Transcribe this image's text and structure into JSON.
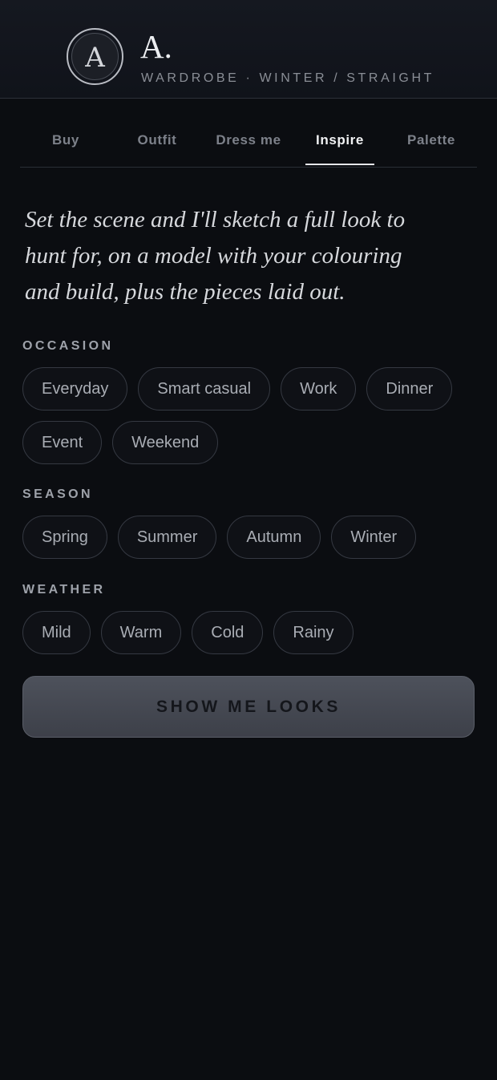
{
  "header": {
    "avatar_letter": "A",
    "title": "A.",
    "subtitle": "WARDROBE · WINTER / STRAIGHT"
  },
  "tabs": [
    {
      "label": "Buy",
      "active": false
    },
    {
      "label": "Outfit",
      "active": false
    },
    {
      "label": "Dress me",
      "active": false
    },
    {
      "label": "Inspire",
      "active": true
    },
    {
      "label": "Palette",
      "active": false
    }
  ],
  "intro": "Set the scene and I'll sketch a full look to hunt for, on a model with your colouring and build, plus the pieces laid out.",
  "occasion": {
    "label": "OCCASION",
    "options": [
      "Everyday",
      "Smart casual",
      "Work",
      "Dinner",
      "Event",
      "Weekend"
    ]
  },
  "season": {
    "label": "SEASON",
    "options": [
      "Spring",
      "Summer",
      "Autumn",
      "Winter"
    ]
  },
  "weather": {
    "label": "WEATHER",
    "options": [
      "Mild",
      "Warm",
      "Cold",
      "Rainy"
    ]
  },
  "cta_label": "SHOW ME LOOKS",
  "colors": {
    "background": "#0b0d11",
    "chip_border": "#353942",
    "cta_fill": "#464a53",
    "active_tab": "#f1f2f4"
  }
}
